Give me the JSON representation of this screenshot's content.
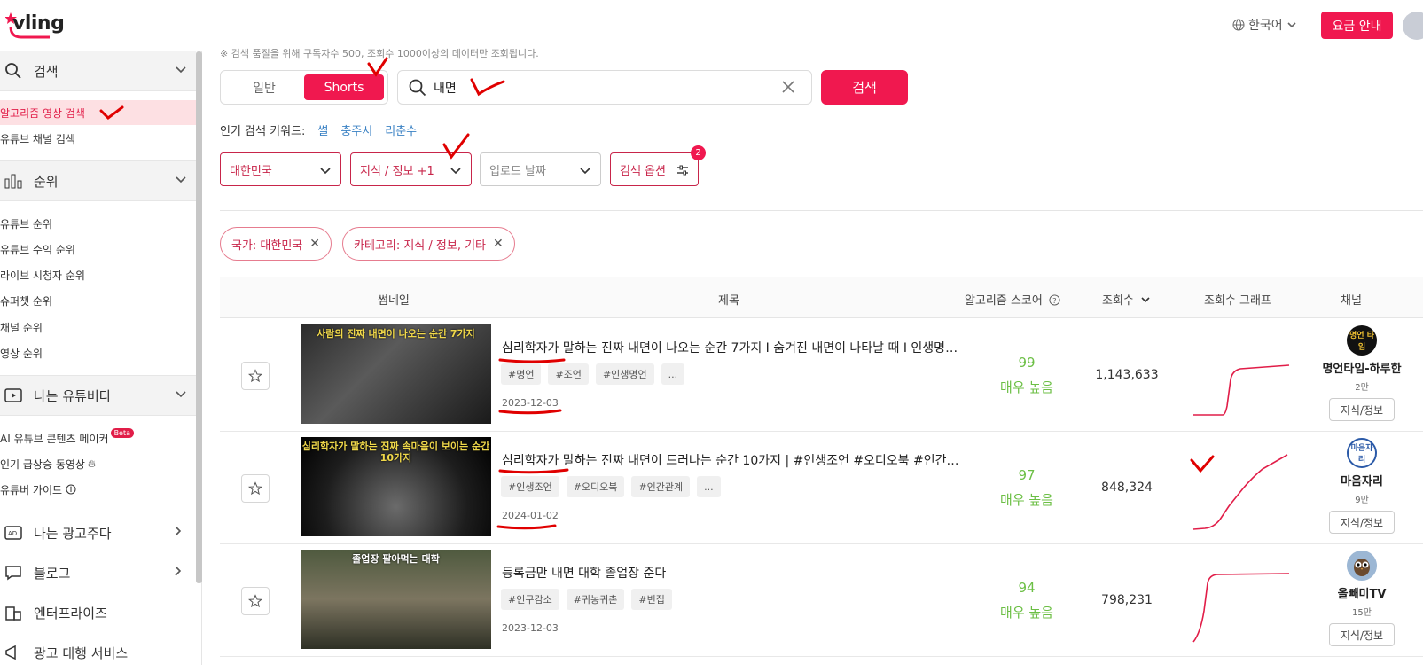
{
  "header": {
    "logo": "vling",
    "language": "한국어",
    "pricing_button": "요금 안내"
  },
  "sidebar": {
    "search_section": "검색",
    "search_items": [
      "알고리즘 영상 검색",
      "유튜브 채널 검색"
    ],
    "ranking_section": "순위",
    "ranking_items": [
      "유튜브 순위",
      "유튜브 수익 순위",
      "라이브 시청자 순위",
      "슈퍼챗 순위",
      "채널 순위",
      "영상 순위"
    ],
    "youtuber_section": "나는 유튜버다",
    "youtuber_items": [
      "AI 유튜브 콘텐츠 메이커",
      "인기 급상승 동영상",
      "유튜버 가이드"
    ],
    "beta_label": "Beta",
    "advertiser_section": "나는 광고주다",
    "blog_section": "블로그",
    "enterprise_section": "엔터프라이즈",
    "cut_section": "광고 대행 서비스"
  },
  "main": {
    "notice": "※ 검색 품질을 위해 구독자수 500, 조회수 1000이상의 데이터만 조회됩니다.",
    "toggle": {
      "normal": "일반",
      "shorts": "Shorts"
    },
    "search": {
      "value": "내면"
    },
    "search_button": "검색",
    "popular_label": "인기 검색 키워드:",
    "popular_keywords": [
      "썰",
      "충주시",
      "리춘수"
    ],
    "filters": {
      "country": "대한민국",
      "category": "지식 / 정보 +1",
      "upload_date": "업로드 날짜",
      "options": "검색 옵션",
      "options_badge": "2"
    },
    "chips": [
      "국가: 대한민국",
      "카테고리: 지식 / 정보, 기타"
    ]
  },
  "table": {
    "headers": {
      "thumbnail": "썸네일",
      "title": "제목",
      "score": "알고리즘 스코어",
      "views": "조회수",
      "graph": "조회수 그래프",
      "channel": "채널"
    },
    "rows": [
      {
        "thumb_text": "사람의 진짜 내면이 나오는 순간 7가지",
        "title": "심리학자가 말하는 진짜 내면이 나오는 순간 7가지 I 숨겨진 내면이 나타날 때 I 인생명언 ...",
        "tags": [
          "#명언",
          "#조언",
          "#인생명언",
          "..."
        ],
        "date": "2023-12-03",
        "score": "99",
        "score_label": "매우 높음",
        "views": "1,143,633",
        "channel_name": "명언타임-하루한",
        "channel_avatar": "명언 타임",
        "channel_subs": "2만",
        "channel_category": "지식/정보"
      },
      {
        "thumb_text": "심리학자가 말하는 진짜 속마음이 보이는 순간 10가지",
        "title": "심리학자가 말하는 진짜 내면이 드러나는 순간 10가지 | #인생조언 #오디오북 #인간관...",
        "tags": [
          "#인생조언",
          "#오디오북",
          "#인간관계",
          "..."
        ],
        "date": "2024-01-02",
        "score": "97",
        "score_label": "매우 높음",
        "views": "848,324",
        "channel_name": "마음자리",
        "channel_avatar": "마음자리",
        "channel_subs": "9만",
        "channel_category": "지식/정보"
      },
      {
        "thumb_text": "졸업장 팔아먹는 대학",
        "title": "등록금만 내면 대학 졸업장 준다",
        "tags": [
          "#인구감소",
          "#귀농귀촌",
          "#빈집"
        ],
        "date": "2023-12-03",
        "score": "94",
        "score_label": "매우 높음",
        "views": "798,231",
        "channel_name": "올빼미TV",
        "channel_avatar": "",
        "channel_subs": "15만",
        "channel_category": "지식/정보"
      }
    ]
  },
  "colors": {
    "accent": "#f0184f",
    "score_green": "#6cbf45",
    "annotation_red": "#e00000"
  }
}
